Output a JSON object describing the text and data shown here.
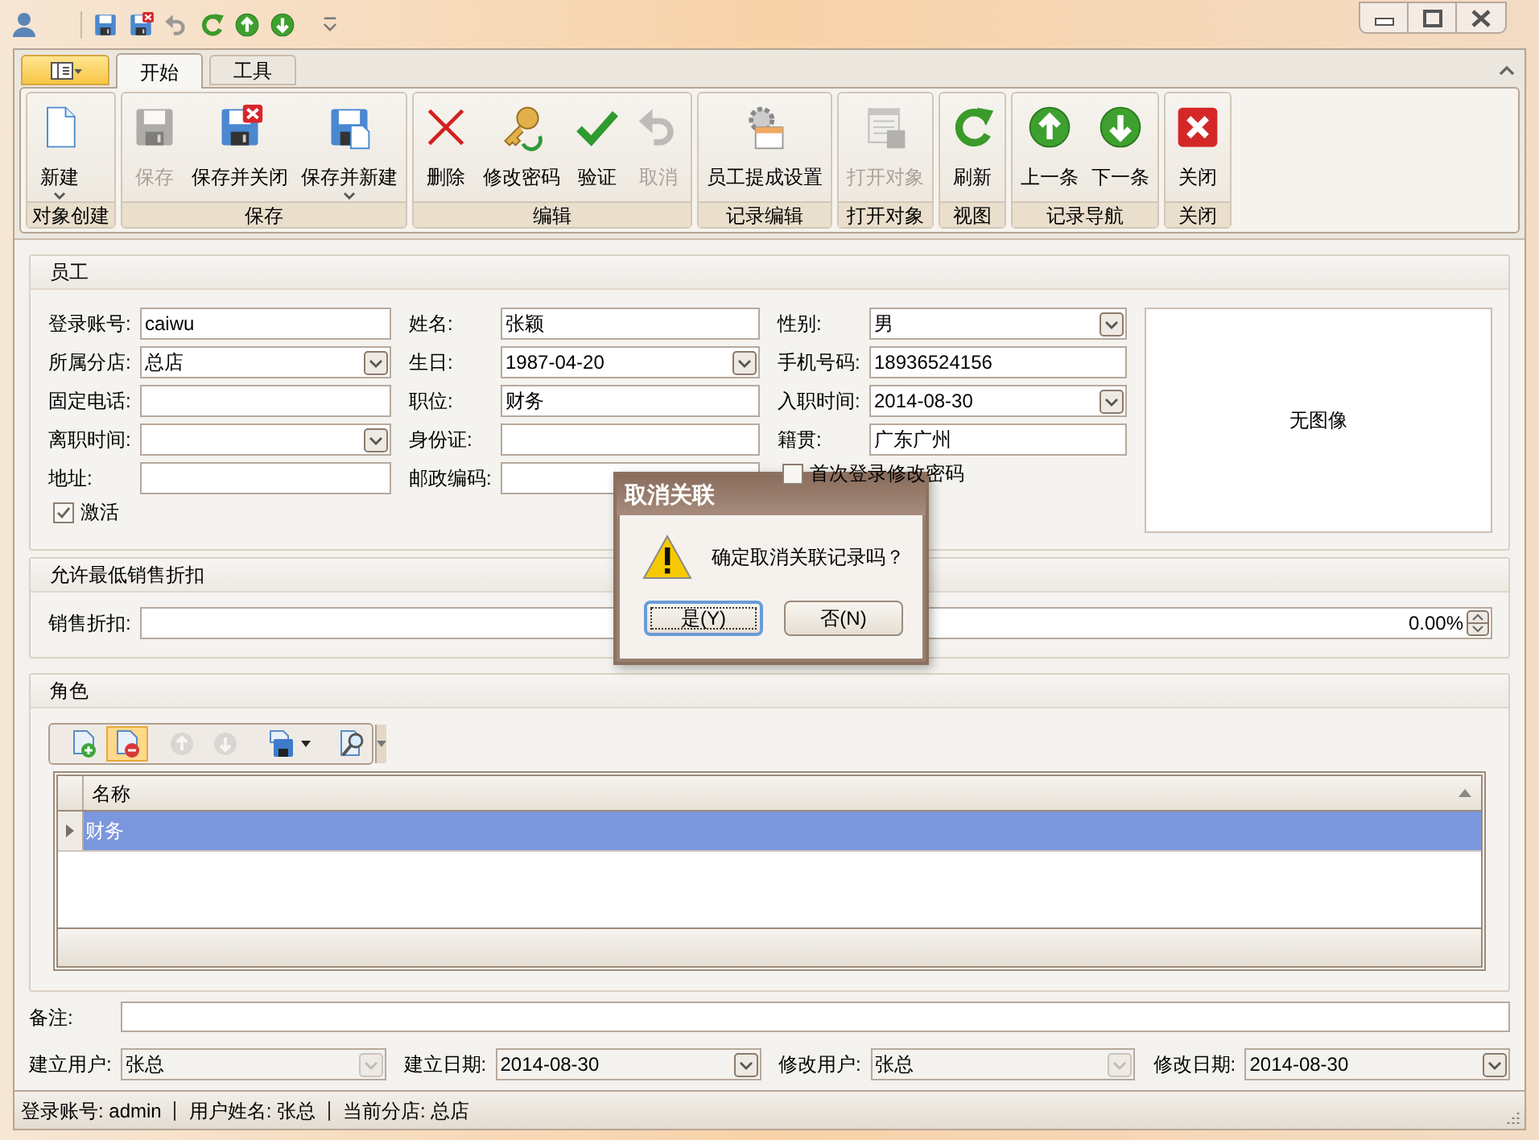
{
  "ribbon": {
    "tabs": [
      {
        "label": "开始",
        "selected": true
      },
      {
        "label": "工具",
        "selected": false
      }
    ],
    "groups": [
      {
        "label": "对象创建",
        "buttons": [
          {
            "label": "新建",
            "disabled": false,
            "dropdown": true
          }
        ]
      },
      {
        "label": "保存",
        "buttons": [
          {
            "label": "保存",
            "disabled": true,
            "dropdown": false
          },
          {
            "label": "保存并关闭",
            "disabled": false,
            "dropdown": false
          },
          {
            "label": "保存并新建",
            "disabled": false,
            "dropdown": true
          }
        ]
      },
      {
        "label": "编辑",
        "buttons": [
          {
            "label": "删除",
            "disabled": false,
            "dropdown": false
          },
          {
            "label": "修改密码",
            "disabled": false,
            "dropdown": false
          },
          {
            "label": "验证",
            "disabled": false,
            "dropdown": false
          },
          {
            "label": "取消",
            "disabled": true,
            "dropdown": false
          }
        ]
      },
      {
        "label": "记录编辑",
        "buttons": [
          {
            "label": "员工提成设置",
            "disabled": false,
            "dropdown": false
          }
        ]
      },
      {
        "label": "打开对象",
        "buttons": [
          {
            "label": "打开对象",
            "disabled": true,
            "dropdown": false
          }
        ]
      },
      {
        "label": "视图",
        "buttons": [
          {
            "label": "刷新",
            "disabled": false,
            "dropdown": false
          }
        ]
      },
      {
        "label": "记录导航",
        "buttons": [
          {
            "label": "上一条",
            "disabled": false,
            "dropdown": false
          },
          {
            "label": "下一条",
            "disabled": false,
            "dropdown": false
          }
        ]
      },
      {
        "label": "关闭",
        "buttons": [
          {
            "label": "关闭",
            "disabled": false,
            "dropdown": false
          }
        ]
      }
    ]
  },
  "employee": {
    "title": "员工",
    "photo": "无图像",
    "fields": [
      {
        "kind": "text",
        "label": "登录账号:",
        "value": "caiwu"
      },
      {
        "kind": "text",
        "label": "姓名:",
        "value": "张颖"
      },
      {
        "kind": "combo",
        "label": "性别:",
        "value": "男"
      },
      {
        "kind": "combo",
        "label": "所属分店:",
        "value": "总店"
      },
      {
        "kind": "combo",
        "label": "生日:",
        "value": "1987-04-20"
      },
      {
        "kind": "text",
        "label": "手机号码:",
        "value": "18936524156"
      },
      {
        "kind": "text",
        "label": "固定电话:"
      },
      {
        "kind": "text",
        "label": "职位:",
        "value": "财务"
      },
      {
        "kind": "combo",
        "label": "入职时间:",
        "value": "2014-08-30"
      },
      {
        "kind": "combo",
        "label": "离职时间:"
      },
      {
        "kind": "text",
        "label": "身份证:"
      },
      {
        "kind": "text",
        "label": "籍贯:",
        "value": "广东广州"
      },
      {
        "kind": "text",
        "label": "地址:"
      },
      {
        "kind": "text",
        "label": "邮政编码:"
      },
      {
        "kind": "checkbox",
        "label": "首次登录修改密码",
        "checked": false
      },
      {
        "kind": "checkbox",
        "label": "激活",
        "checked": true
      }
    ]
  },
  "discount": {
    "title": "允许最低销售折扣",
    "label": "销售折扣:",
    "value": "0.00%"
  },
  "roles": {
    "title": "角色",
    "toolbar": [
      {
        "highlighted": false,
        "disabled": false
      },
      {
        "highlighted": true,
        "disabled": false
      },
      {
        "highlighted": false,
        "disabled": true
      },
      {
        "highlighted": false,
        "disabled": true
      },
      {
        "highlighted": false,
        "disabled": false
      },
      {
        "highlighted": false,
        "disabled": false
      }
    ],
    "columns": [
      "名称"
    ],
    "rows": [
      {
        "cells": [
          "财务"
        ],
        "selected": true
      }
    ]
  },
  "notes": {
    "label": "备注:"
  },
  "audit": [
    {
      "label": "建立用户:",
      "value": "张总",
      "disabled": true
    },
    {
      "label": "建立日期:",
      "value": "2014-08-30",
      "disabled": false
    },
    {
      "label": "修改用户:",
      "value": "张总",
      "disabled": true
    },
    {
      "label": "修改日期:",
      "value": "2014-08-30",
      "disabled": false
    }
  ],
  "status_bar": [
    "登录账号: admin",
    "用户姓名: 张总",
    "当前分店: 总店"
  ],
  "dialog": {
    "title": "取消关联",
    "message": "确定取消关联记录吗？",
    "buttons": [
      {
        "label": "是(Y)",
        "focused": true
      },
      {
        "label": "否(N)",
        "focused": false
      }
    ]
  }
}
